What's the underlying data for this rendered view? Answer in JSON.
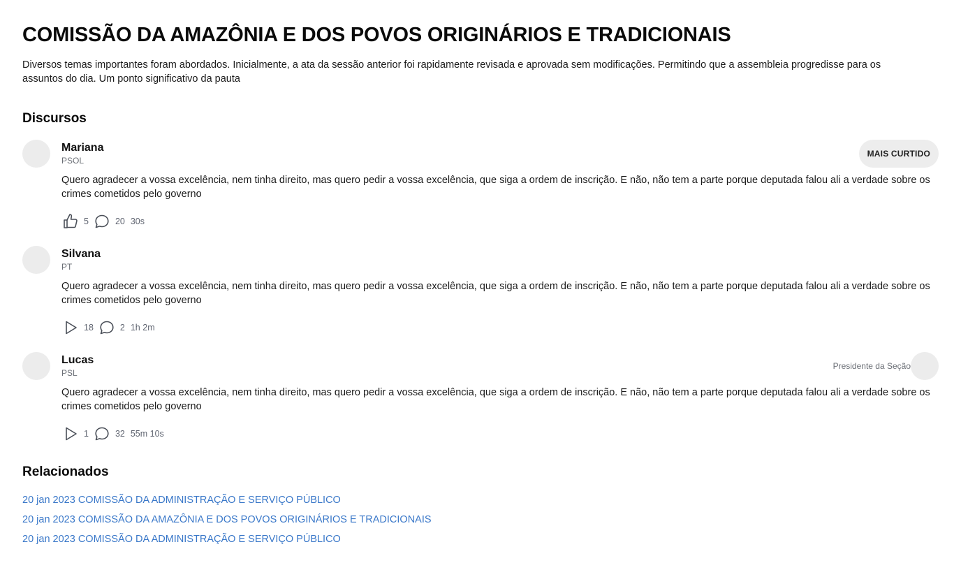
{
  "header": {
    "title": "COMISSÃO DA AMAZÔNIA E DOS POVOS ORIGINÁRIOS E TRADICIONAIS",
    "description": "Diversos temas importantes foram abordados. Inicialmente, a ata da sessão anterior foi rapidamente revisada e aprovada sem modificações. Permitindo que a assembleia progredisse para os assuntos do dia. Um ponto significativo da pauta"
  },
  "discursos": {
    "title": "Discursos",
    "items": [
      {
        "name": "Mariana",
        "party": "PSOL",
        "text": "Quero agradecer a vossa excelência, nem tinha direito, mas quero pedir a vossa excelência, que siga a ordem de inscrição. E não, não tem a parte porque deputada falou ali a verdade sobre os crimes cometidos pelo governo",
        "reaction_icon": "thumbs-up-icon",
        "reaction_count": "5",
        "comment_count": "20",
        "duration": "30s",
        "badge": "MAIS CURTIDO"
      },
      {
        "name": "Silvana",
        "party": "PT",
        "text": "Quero agradecer a vossa excelência, nem tinha direito, mas quero pedir a vossa excelência, que siga a ordem de inscrição. E não, não tem a parte porque deputada falou ali a verdade sobre os crimes cometidos pelo governo",
        "reaction_icon": "play-icon",
        "reaction_count": "18",
        "comment_count": "2",
        "duration": "1h 2m"
      },
      {
        "name": "Lucas",
        "party": "PSL",
        "text": "Quero agradecer a vossa excelência, nem tinha direito, mas quero pedir a vossa excelência, que siga a ordem de inscrição. E não, não tem a parte porque deputada falou ali a verdade sobre os crimes cometidos pelo governo",
        "reaction_icon": "play-icon",
        "reaction_count": "1",
        "comment_count": "32",
        "duration": "55m 10s",
        "role_label": "Presidente da Seção"
      }
    ]
  },
  "relacionados": {
    "title": "Relacionados",
    "items": [
      "20 jan 2023 COMISSÃO DA ADMINISTRAÇÃO E SERVIÇO PÚBLICO",
      "20 jan 2023 COMISSÃO DA AMAZÔNIA E DOS POVOS ORIGINÁRIOS E TRADICIONAIS",
      "20 jan 2023 COMISSÃO DA ADMINISTRAÇÃO E SERVIÇO PÚBLICO"
    ]
  },
  "colors": {
    "link": "#3a78c9",
    "avatar_placeholder": "#ececec",
    "badge_bg": "#ededed",
    "muted_text": "#6b6f76"
  }
}
